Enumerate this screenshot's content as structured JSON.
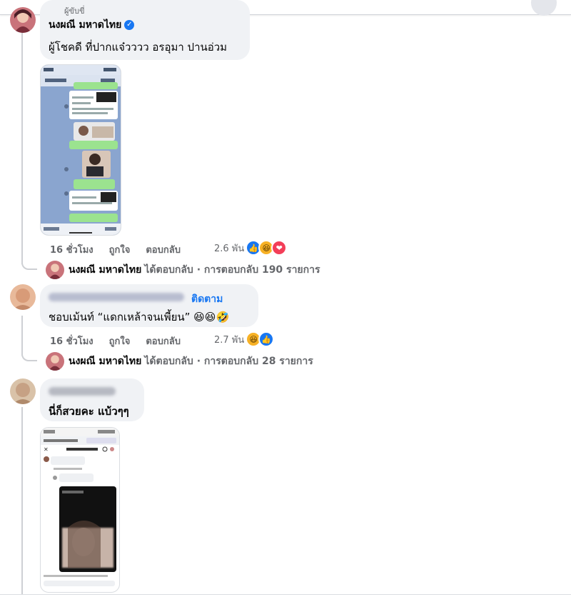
{
  "comment1": {
    "top_label": "ผู้ขับขี่",
    "author": "นงผณี มหาดไทย",
    "text": "ผู้โชคดี ที่ปากแจ๋วววว อรอุมา ปานอ่วม",
    "time": "16 ชั่วโมง",
    "like_label": "ถูกใจ",
    "reply_label": "ตอบกลับ",
    "reaction_count": "2.6 พัน",
    "reactions": [
      "like-icon",
      "haha-icon",
      "love-icon"
    ],
    "replies_author": "นงผณี มหาดไทย",
    "replies_text": "ได้ตอบกลับ · การตอบกลับ 190 รายการ"
  },
  "comment2": {
    "follow_label": "ติดตาม",
    "text": "ชอบเม้นท์ “แดกเหล้าจนเพี้ยน” 😆😆🤣",
    "time": "16 ชั่วโมง",
    "like_label": "ถูกใจ",
    "reply_label": "ตอบกลับ",
    "reaction_count": "2.7 พัน",
    "reactions": [
      "haha-icon",
      "like-icon"
    ],
    "replies_author": "นงผณี มหาดไทย",
    "replies_text": "ได้ตอบกลับ · การตอบกลับ 28 รายการ"
  },
  "comment3": {
    "text": "นี่ก็สวยคะ แบ้วๆๆ"
  },
  "colors": {
    "accent": "#1877f2",
    "bubble": "#f0f2f5",
    "meta": "#65676b",
    "chat_green": "#9be38f",
    "chat_bg": "#8aa5cf"
  }
}
